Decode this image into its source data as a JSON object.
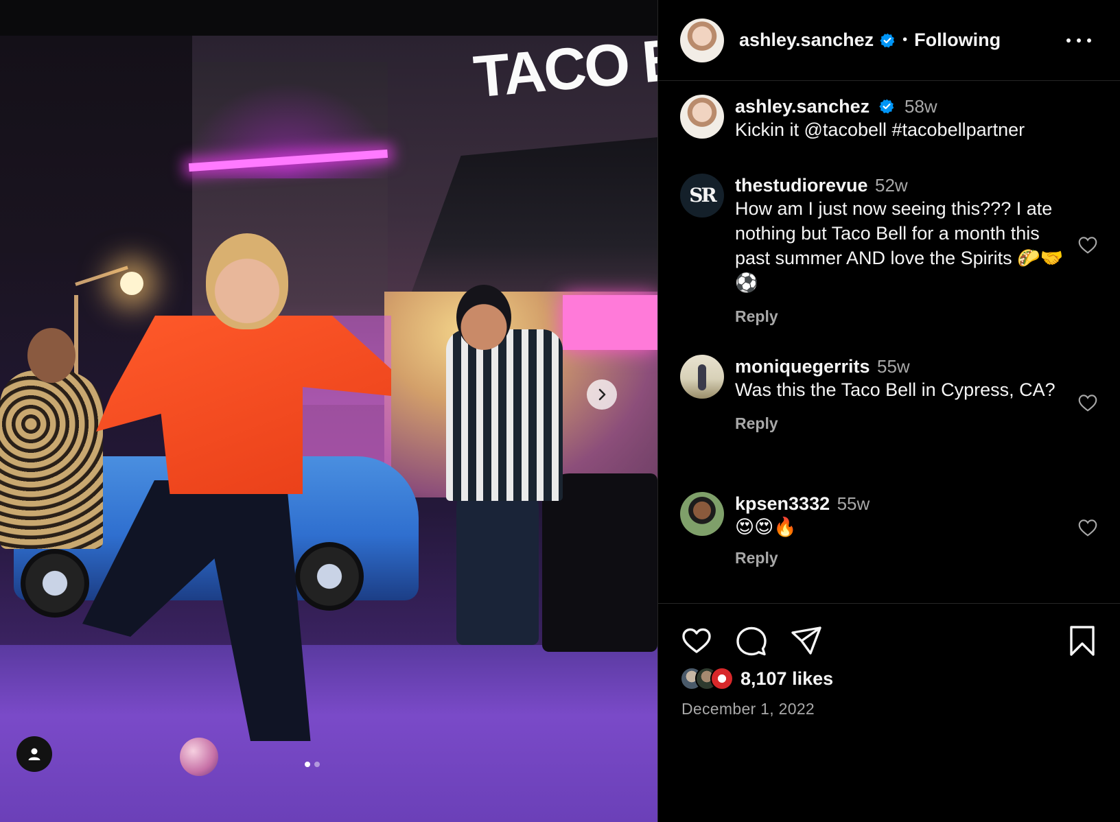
{
  "post": {
    "media": {
      "sign_text": "TACO BE",
      "carousel": {
        "count": 2,
        "active_index": 0
      }
    },
    "header": {
      "username": "ashley.sanchez",
      "separator": "•",
      "follow_status": "Following"
    },
    "caption": {
      "username": "ashley.sanchez",
      "time": "58w",
      "text": "Kickin it @tacobell #tacobellpartner"
    },
    "comments": [
      {
        "username": "thestudiorevue",
        "avatar_text": "SR",
        "time": "52w",
        "text": "How am I just now seeing this??? I ate nothing but Taco Bell for a month this past summer AND love the Spirits 🌮🤝⚽",
        "reply_label": "Reply"
      },
      {
        "username": "moniquegerrits",
        "time": "55w",
        "text": "Was this the Taco Bell in Cypress, CA?",
        "reply_label": "Reply"
      },
      {
        "username": "kpsen3332",
        "time": "55w",
        "text": "😍😍🔥",
        "reply_label": "Reply"
      }
    ],
    "likes": "8,107 likes",
    "date": "December 1, 2022",
    "icons": {
      "verified": "verified-badge-icon",
      "more": "more-options-icon",
      "like": "heart-icon",
      "comment": "comment-bubble-icon",
      "share": "paper-plane-icon",
      "save": "bookmark-icon",
      "next": "chevron-right-icon",
      "tags": "user-tag-icon"
    },
    "colors": {
      "background": "#000000",
      "text": "#f5f5f5",
      "secondary_text": "#a8a8a8",
      "verified": "#0095f6",
      "divider": "#262626"
    }
  }
}
